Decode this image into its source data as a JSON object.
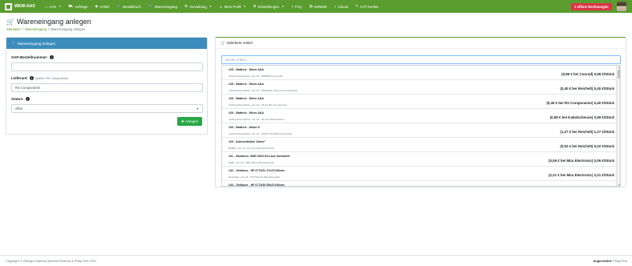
{
  "navbar": {
    "brand": "WEW-AAS",
    "items": [
      {
        "icon": "home-icon",
        "glyph": "⌂",
        "label": "AAS",
        "dropdown": true
      },
      {
        "icon": "truck-icon",
        "glyph": "⛟",
        "label": "Aufträge",
        "dropdown": false
      },
      {
        "icon": "tag-icon",
        "glyph": "◆",
        "label": "Artikel",
        "dropdown": false
      },
      {
        "icon": "cart-icon",
        "glyph": "🛒",
        "label": "Bestellbuch",
        "dropdown": false
      },
      {
        "icon": "cart-icon",
        "glyph": "🛒",
        "label": "Wareneingang",
        "dropdown": false
      },
      {
        "icon": "gear-icon",
        "glyph": "⚙",
        "label": "Verwaltung",
        "dropdown": true
      },
      {
        "icon": "user-icon",
        "glyph": "☺",
        "label": "Mein Profil",
        "dropdown": true
      },
      {
        "icon": "gear-icon",
        "glyph": "⚙",
        "label": "Einstellungen",
        "dropdown": true
      },
      {
        "icon": "question-icon",
        "glyph": "?",
        "label": "FAQ",
        "dropdown": false
      },
      {
        "icon": "book-icon",
        "glyph": "▤",
        "label": "EMWeb",
        "dropdown": false
      },
      {
        "icon": "branch-icon",
        "glyph": "⑂",
        "label": "GitLab",
        "dropdown": false
      },
      {
        "icon": "wrench-icon",
        "glyph": "✎",
        "label": "CO²-Geräte",
        "dropdown": false
      }
    ],
    "alert": "1 offene Rechnungen"
  },
  "page": {
    "title": "Wareneingang anlegen",
    "breadcrumb": [
      "Startseite",
      "Wareneingang",
      "Wareneingang anlegen"
    ]
  },
  "form": {
    "header": "Wareneingang anlegen",
    "sap_label": "SAP-Bestellnummer:",
    "sap_value": "",
    "supplier_label": "Lieferant:",
    "supplier_hint": "Quelle: RS Components",
    "supplier_value": "RS Components",
    "status_label": "Status:",
    "status_value": "offen",
    "submit_label": "Anlegen"
  },
  "articles": {
    "header": "Gelieferte Artikel",
    "search_placeholder": "Suche Artikel...",
    "items": [
      {
        "title": "#25 - Batterie - Micro AAA",
        "sub": "Verbrauchsmaterial - Art.-Nr.: 228898 bei Conrad",
        "price": "(0,99 € bei Conrad) 0,99 €/Stück"
      },
      {
        "title": "#25 - Batterie - Micro AAA",
        "sub": "Verbrauchsmaterial - Art.-Nr.: PROCELL AAA (Ue bei Reichelt)",
        "price": "(0,40 € bei Reichelt) 0,40 €/Stück"
      },
      {
        "title": "#25 - Batterie - Micro AAA",
        "sub": "Verbrauchsmaterial - Art.-Nr.: 33 bei RS Components",
        "price": "(0,40 € bei RS Components) 0,40 €/Stück"
      },
      {
        "title": "#25 - Batterie - Micro AAA",
        "sub": "Verbrauchsmaterial - Art.-Nr.: 33 bei Kabelscheune",
        "price": "(0,59 € bei Kabelscheune) 0,59 €/Stück"
      },
      {
        "title": "#26 - Batterie - Mono D",
        "sub": "Verbrauchsmaterial - Art.-Nr.: CMAN HO-D20 bei Reichelt",
        "price": "(1,27 € bei Reichelt) 1,27 €/Stück"
      },
      {
        "title": "#29 - Aderendhülse 10mm²",
        "sub": "EMBH - Art.-Nr.: H27-10-100 bei Reichelt",
        "price": "(0,02 € bei Reichelt) 0,02 €/Stück"
      },
      {
        "title": "#31 - Bumbers: SMD 0603 E12 aus Sortiment",
        "sub": "SMD - Art.-Nr.: 4361 50x1 Mira Electronic",
        "price": "(0,06 € bei Mira Electronic) 0,06 €/Stück"
      },
      {
        "title": "#32 - Gehäuse - HF 6772/31 37x37x30mm",
        "sub": "Rest/sale - Art.-Nr.: 6772/31 bei Mira Electronic",
        "price": "(2,21 € bei Mira Electronic) 2,21 €/Stück"
      },
      {
        "title": "#33 - Gehäuse - HF 6773/30 55x37x30mm",
        "sub": "",
        "price": ""
      }
    ]
  },
  "footer": {
    "copyright": "Copyright © Warlight Systems (Marius Reischl) & Philip Ruh 2021",
    "logged_in_label": "Angemeldet:",
    "logged_in_user": "Philip Ruh"
  }
}
